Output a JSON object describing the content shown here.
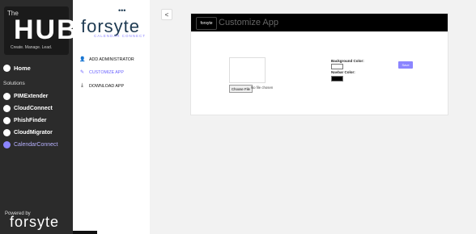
{
  "hub": {
    "the": "The",
    "title": "HUB",
    "tagline": "Create. Manage. Lead.",
    "nav": [
      {
        "label": "Home"
      },
      {
        "label": "Solutions"
      },
      {
        "label": "PIMExtender"
      },
      {
        "label": "CloudConnect"
      },
      {
        "label": "PhishFinder"
      },
      {
        "label": "CloudMigrator"
      },
      {
        "label": "CalendarConnect"
      }
    ],
    "powered_by": "Powered by",
    "footer_logo": "forsyte",
    "accent": "#8b85ff"
  },
  "forsyte": {
    "logo_text": "forsyte",
    "logo_sub": "CALENDAR CONNECT",
    "menu": [
      {
        "label": "ADD ADMINISTRATOR",
        "icon": "user-plus-icon"
      },
      {
        "label": "CUSTOMIZE APP",
        "icon": "pencil-icon"
      },
      {
        "label": "DOWNLOAD APP",
        "icon": "download-icon"
      }
    ]
  },
  "back_button": "<",
  "card": {
    "logo_text": "forsyte",
    "title": "Customize App",
    "choose_file": "Choose File",
    "no_file": "No file chosen",
    "background_color_label": "Background Color:",
    "navbar_color_label": "Navbar Color:",
    "save_label": "Save"
  }
}
